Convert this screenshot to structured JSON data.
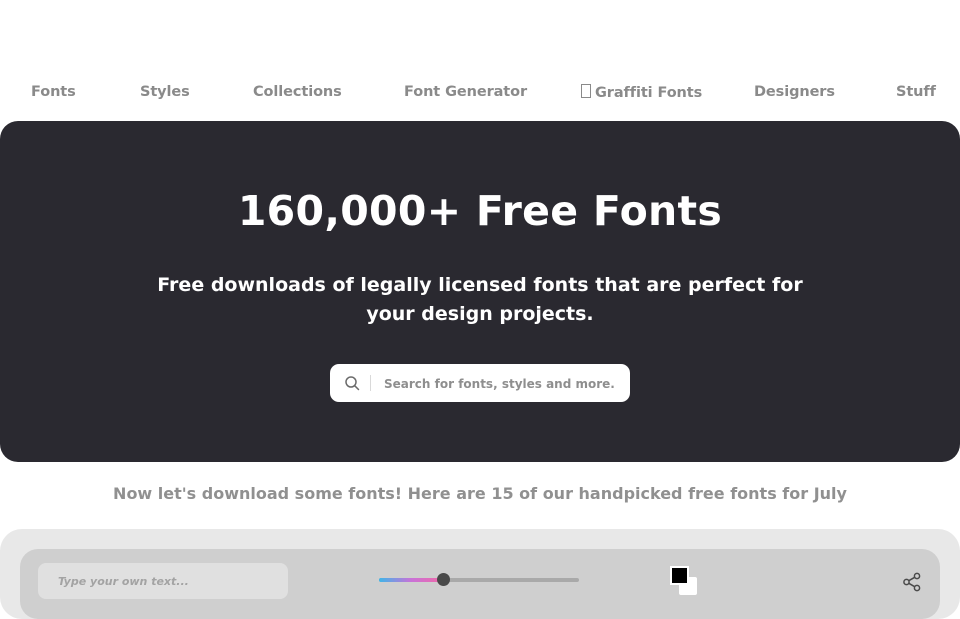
{
  "nav": {
    "items": [
      {
        "label": "Fonts"
      },
      {
        "label": "Styles"
      },
      {
        "label": "Collections"
      },
      {
        "label": "Font Generator"
      },
      {
        "label": "Graffiti Fonts"
      },
      {
        "label": "Designers"
      },
      {
        "label": "Stuff"
      }
    ]
  },
  "hero": {
    "title": "160,000+ Free Fonts",
    "subtitle": "Free downloads of legally licensed fonts that are perfect for your design projects.",
    "search_placeholder": "Search for fonts, styles and more."
  },
  "main": {
    "heading": "Now let's download some fonts! Here are 15 of our handpicked free fonts for July"
  },
  "toolbar": {
    "preview_placeholder": "Type your own text...",
    "size_slider_level": 0.32,
    "text_color": "#000000",
    "background_color": "#ffffff"
  },
  "colors": {
    "hero_bg": "#2a2930",
    "nav_text": "#8a8a8a",
    "subheading_text": "#909090"
  },
  "icons": {
    "search": "search-icon",
    "share": "share-icon"
  }
}
